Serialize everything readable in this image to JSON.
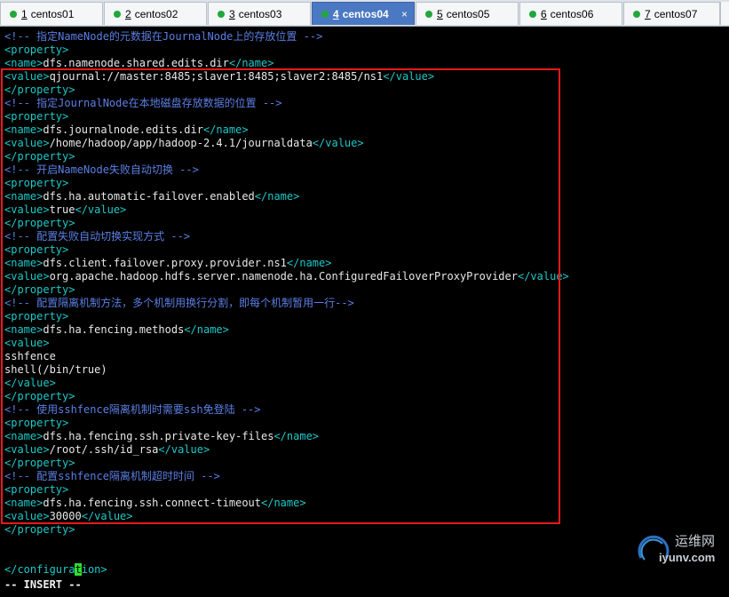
{
  "tabs": [
    {
      "num": "1",
      "label": "centos01",
      "active": false,
      "close": ""
    },
    {
      "num": "2",
      "label": "centos02",
      "active": false,
      "close": ""
    },
    {
      "num": "3",
      "label": "centos03",
      "active": false,
      "close": ""
    },
    {
      "num": "4",
      "label": "centos04",
      "active": true,
      "close": "×"
    },
    {
      "num": "5",
      "label": "centos05",
      "active": false,
      "close": ""
    },
    {
      "num": "6",
      "label": "centos06",
      "active": false,
      "close": ""
    },
    {
      "num": "7",
      "label": "centos07",
      "active": false,
      "close": ""
    }
  ],
  "editor": {
    "lines": [
      {
        "type": "comment",
        "text": "<!-- 指定NameNode的元数据在JournalNode上的存放位置 -->"
      },
      {
        "type": "tag",
        "text": "<property>"
      },
      {
        "type": "kv",
        "open": "<name>",
        "value": "dfs.namenode.shared.edits.dir",
        "close": "</name>"
      },
      {
        "type": "kv",
        "open": "<value>",
        "value": "qjournal://master:8485;slaver1:8485;slaver2:8485/ns1",
        "close": "</value>"
      },
      {
        "type": "tag",
        "text": "</property>"
      },
      {
        "type": "comment",
        "text": "<!-- 指定JournalNode在本地磁盘存放数据的位置 -->"
      },
      {
        "type": "tag",
        "text": "<property>"
      },
      {
        "type": "kv",
        "open": "<name>",
        "value": "dfs.journalnode.edits.dir",
        "close": "</name>"
      },
      {
        "type": "kv",
        "open": "<value>",
        "value": "/home/hadoop/app/hadoop-2.4.1/journaldata",
        "close": "</value>"
      },
      {
        "type": "tag",
        "text": "</property>"
      },
      {
        "type": "comment",
        "text": "<!-- 开启NameNode失败自动切换 -->"
      },
      {
        "type": "tag",
        "text": "<property>"
      },
      {
        "type": "kv",
        "open": "<name>",
        "value": "dfs.ha.automatic-failover.enabled",
        "close": "</name>"
      },
      {
        "type": "kv",
        "open": "<value>",
        "value": "true",
        "close": "</value>"
      },
      {
        "type": "tag",
        "text": "</property>"
      },
      {
        "type": "comment",
        "text": "<!-- 配置失败自动切换实现方式 -->"
      },
      {
        "type": "tag",
        "text": "<property>"
      },
      {
        "type": "kv",
        "open": "<name>",
        "value": "dfs.client.failover.proxy.provider.ns1",
        "close": "</name>"
      },
      {
        "type": "kv",
        "open": "<value>",
        "value": "org.apache.hadoop.hdfs.server.namenode.ha.ConfiguredFailoverProxyProvider",
        "close": "</value>"
      },
      {
        "type": "tag",
        "text": "</property>"
      },
      {
        "type": "comment",
        "text": "<!-- 配置隔离机制方法，多个机制用换行分割，即每个机制暂用一行-->"
      },
      {
        "type": "tag",
        "text": "<property>"
      },
      {
        "type": "kv",
        "open": "<name>",
        "value": "dfs.ha.fencing.methods",
        "close": "</name>"
      },
      {
        "type": "tag",
        "text": "<value>"
      },
      {
        "type": "text",
        "text": "sshfence"
      },
      {
        "type": "text",
        "text": "shell(/bin/true)"
      },
      {
        "type": "tag",
        "text": "</value>"
      },
      {
        "type": "tag",
        "text": "</property>"
      },
      {
        "type": "comment",
        "text": "<!-- 使用sshfence隔离机制时需要ssh免登陆 -->"
      },
      {
        "type": "tag",
        "text": "<property>"
      },
      {
        "type": "kv",
        "open": "<name>",
        "value": "dfs.ha.fencing.ssh.private-key-files",
        "close": "</name>"
      },
      {
        "type": "kv",
        "open": "<value>",
        "value": "/root/.ssh/id_rsa",
        "close": "</value>"
      },
      {
        "type": "tag",
        "text": "</property>"
      },
      {
        "type": "comment",
        "text": "<!-- 配置sshfence隔离机制超时时间 -->"
      },
      {
        "type": "tag",
        "text": "<property>"
      },
      {
        "type": "kv",
        "open": "<name>",
        "value": "dfs.ha.fencing.ssh.connect-timeout",
        "close": "</name>"
      },
      {
        "type": "kv",
        "open": "<value>",
        "value": "30000",
        "close": "</value>"
      },
      {
        "type": "tag",
        "text": "</property>"
      },
      {
        "type": "blank",
        "text": ""
      },
      {
        "type": "blank",
        "text": ""
      },
      {
        "type": "cursorline",
        "before": "</configura",
        "cursor": "t",
        "after": "ion>"
      }
    ],
    "status": "-- INSERT --"
  },
  "watermark": {
    "cn": "运维网",
    "en": "iyunv.com"
  },
  "colors": {
    "comment": "#5b7fe5",
    "tag": "#1fc8c8",
    "text": "#e8e8e8",
    "cursor": "#2ee02e",
    "highlight_box": "#e8191c",
    "active_tab": "#4a78c2",
    "status_dot": "#21a83b"
  }
}
